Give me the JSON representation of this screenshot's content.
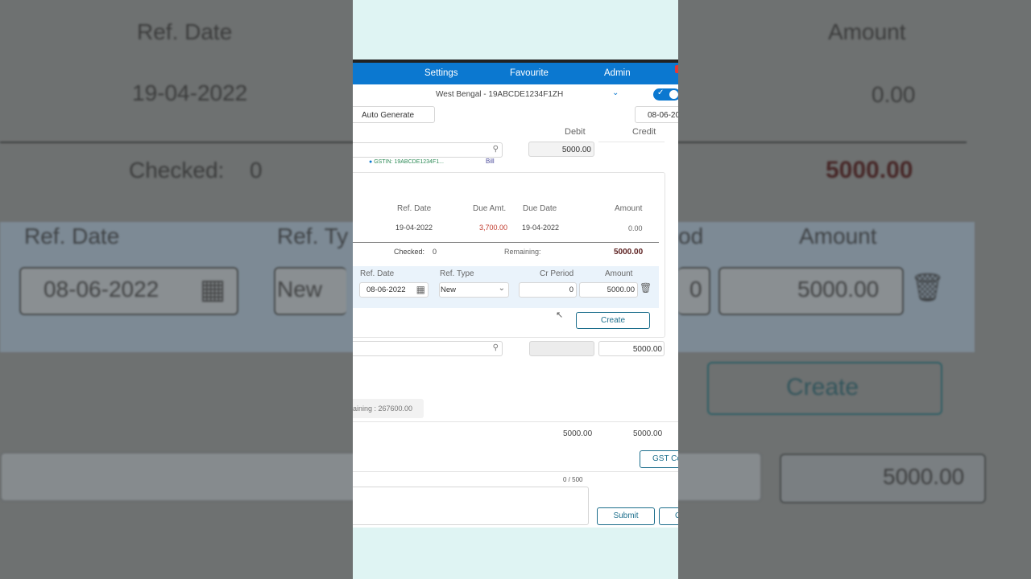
{
  "background": {
    "ref_date_header": "Ref. Date",
    "ref_date_value": "19-04-2022",
    "amount_header": "Amount",
    "amount_value": "0.00",
    "checked_label": "Checked:",
    "checked_value": "0",
    "remaining_amount": "5000.00",
    "row_ref_date_header": "Ref. Date",
    "row_ref_type_header": "Ref. Ty",
    "row_cr_period_header": "od",
    "row_amount_header": "Amount",
    "row_ref_date_value": "08-06-2022",
    "row_ref_type_value": "New",
    "row_cr_period_value": "0",
    "row_amount_value": "5000.00",
    "create_label": "Create",
    "total_value": "5000.00"
  },
  "nav": {
    "settings": "Settings",
    "favourite": "Favourite",
    "admin": "Admin"
  },
  "header": {
    "gstin_select": "West Bengal - 19ABCDE1234F1ZH",
    "auto_generate": "Auto Generate",
    "date": "08-06-20"
  },
  "columns": {
    "debit": "Debit",
    "credit": "Credit"
  },
  "line1": {
    "debit_value": "5000.00",
    "gstin_hint": "GSTIN: 19ABCDE1234F1...",
    "bill_link": "Bill"
  },
  "bill_table": {
    "headers": {
      "ref_date": "Ref. Date",
      "due_amt": "Due Amt.",
      "due_date": "Due Date",
      "amount": "Amount"
    },
    "row": {
      "ref_date": "19-04-2022",
      "due_amt": "3,700.00",
      "due_date": "19-04-2022",
      "amount": "0.00"
    },
    "checked_label": "Checked:",
    "checked_value": "0",
    "remaining_label": "Remaining:",
    "remaining_value": "5000.00"
  },
  "new_ref": {
    "headers": {
      "ref_date": "Ref. Date",
      "ref_type": "Ref. Type",
      "cr_period": "Cr Period",
      "amount": "Amount"
    },
    "ref_date": "08-06-2022",
    "ref_type": "New",
    "cr_period": "0",
    "amount": "5000.00",
    "create_label": "Create"
  },
  "line2": {
    "credit_value": "5000.00"
  },
  "remaining_badge": "aining : 267600.00",
  "totals": {
    "debit": "5000.00",
    "credit": "5000.00"
  },
  "gst_button": "GST Co",
  "narration": {
    "counter": "0 / 500"
  },
  "actions": {
    "submit": "Submit",
    "cancel": "C"
  }
}
